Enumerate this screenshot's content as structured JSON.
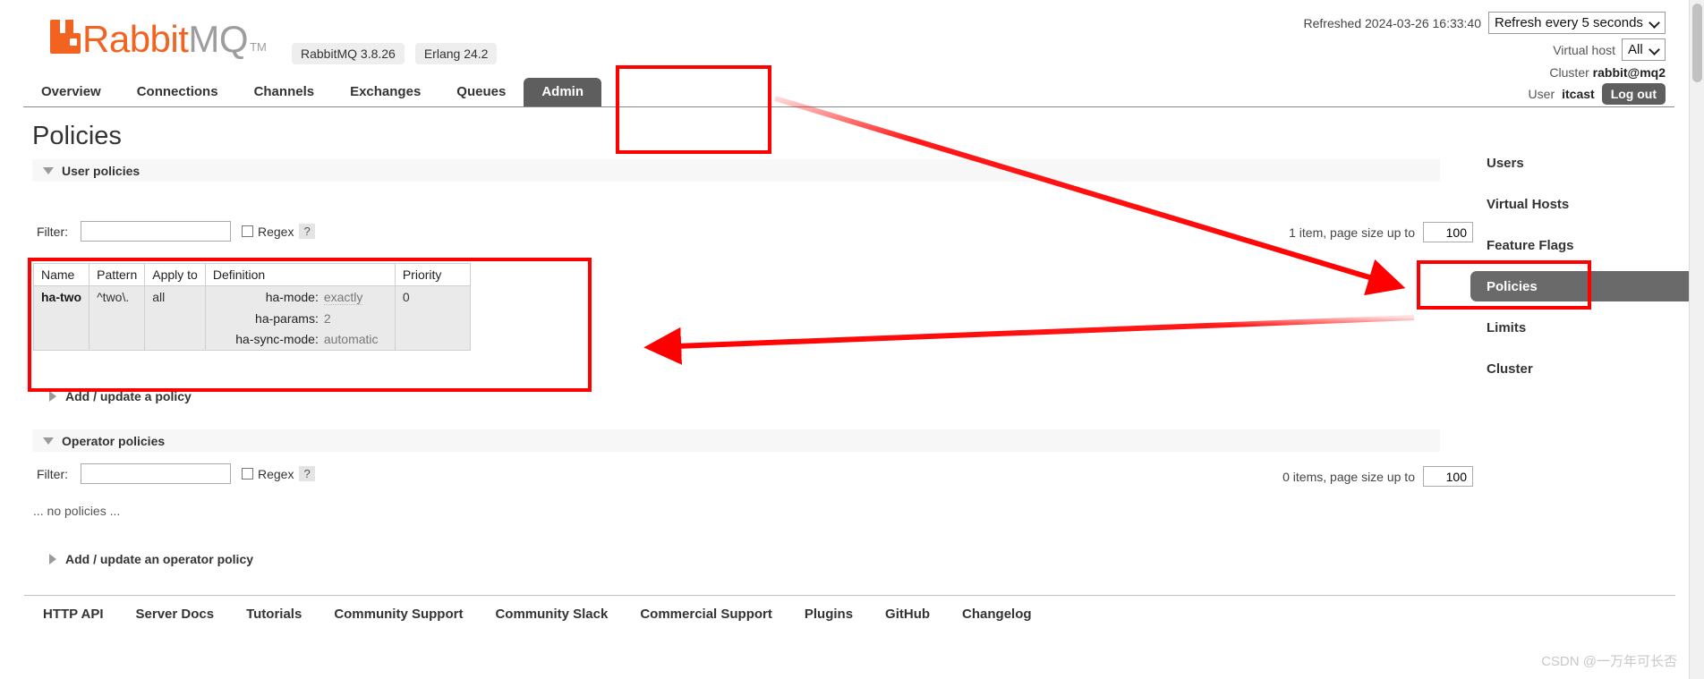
{
  "header": {
    "logo": {
      "rabbit": "Rabbit",
      "mq": "MQ",
      "tm": "TM",
      "icon": "rabbitmq-logo-icon"
    },
    "version_pills": [
      "RabbitMQ 3.8.26",
      "Erlang 24.2"
    ],
    "refreshed_text": "Refreshed 2024-03-26 16:33:40",
    "refresh_select": "Refresh every 5 seconds",
    "vhost_label": "Virtual host",
    "vhost_select": "All",
    "cluster_label": "Cluster",
    "cluster_name": "rabbit@mq2",
    "user_label": "User",
    "user_name": "itcast",
    "logout_label": "Log out"
  },
  "nav": {
    "tabs": [
      {
        "label": "Overview",
        "active": false
      },
      {
        "label": "Connections",
        "active": false
      },
      {
        "label": "Channels",
        "active": false
      },
      {
        "label": "Exchanges",
        "active": false
      },
      {
        "label": "Queues",
        "active": false
      },
      {
        "label": "Admin",
        "active": true
      }
    ]
  },
  "page": {
    "title": "Policies"
  },
  "user_policies": {
    "section_label": "User policies",
    "filter_label": "Filter:",
    "filter_value": "",
    "filter_placeholder": "",
    "regex_label": "Regex",
    "help_label": "?",
    "pagination_text": "1 item, page size up to",
    "page_size_value": "100",
    "columns": [
      "Name",
      "Pattern",
      "Apply to",
      "Definition",
      "Priority"
    ],
    "rows": [
      {
        "name": "ha-two",
        "pattern": "^two\\.",
        "apply_to": "all",
        "definition": [
          {
            "key": "ha-mode:",
            "value": "exactly"
          },
          {
            "key": "ha-params:",
            "value": "2"
          },
          {
            "key": "ha-sync-mode:",
            "value": "automatic"
          }
        ],
        "priority": "0"
      }
    ],
    "add_label": "Add / update a policy"
  },
  "operator_policies": {
    "section_label": "Operator policies",
    "filter_label": "Filter:",
    "filter_value": "",
    "filter_placeholder": "",
    "regex_label": "Regex",
    "help_label": "?",
    "pagination_text": "0 items, page size up to",
    "page_size_value": "100",
    "empty_text": "... no policies ...",
    "add_label": "Add / update an operator policy"
  },
  "admin_menu": {
    "items": [
      {
        "label": "Users",
        "active": false
      },
      {
        "label": "Virtual Hosts",
        "active": false
      },
      {
        "label": "Feature Flags",
        "active": false
      },
      {
        "label": "Policies",
        "active": true
      },
      {
        "label": "Limits",
        "active": false
      },
      {
        "label": "Cluster",
        "active": false
      }
    ]
  },
  "footer": {
    "links": [
      "HTTP API",
      "Server Docs",
      "Tutorials",
      "Community Support",
      "Community Slack",
      "Commercial Support",
      "Plugins",
      "GitHub",
      "Changelog"
    ]
  },
  "watermark": {
    "text": "CSDN @一万年可长否"
  },
  "annotation": {
    "color": "#ff0000"
  }
}
